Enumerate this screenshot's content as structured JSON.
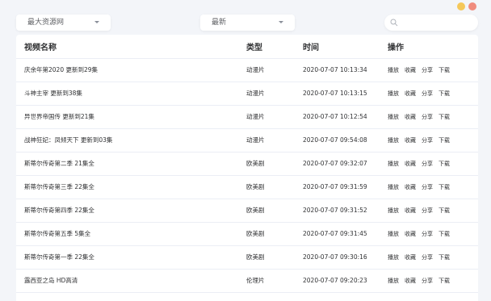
{
  "window": {
    "dots": [
      {
        "name": "minimize",
        "color": "#f5c85a"
      },
      {
        "name": "close",
        "color": "#f08c7e"
      }
    ]
  },
  "filters": {
    "source": {
      "selected": "最大资源网"
    },
    "sort": {
      "selected": "最新"
    },
    "search": {
      "value": "",
      "placeholder": ""
    }
  },
  "table": {
    "headers": {
      "name": "视频名称",
      "type": "类型",
      "time": "时间",
      "ops": "操作"
    },
    "actions": [
      "播放",
      "收藏",
      "分享",
      "下载"
    ],
    "rows": [
      {
        "name": "庆余年第2020 更新到29集",
        "type": "动漫片",
        "time": "2020-07-07 10:13:34"
      },
      {
        "name": "斗神主宰 更新到38集",
        "type": "动漫片",
        "time": "2020-07-07 10:13:15"
      },
      {
        "name": "异世界帝国传 更新到21集",
        "type": "动漫片",
        "time": "2020-07-07 10:12:54"
      },
      {
        "name": "战神狂妃：凤倾天下 更新到03集",
        "type": "动漫片",
        "time": "2020-07-07 09:54:08"
      },
      {
        "name": "斯蒂尔传奇第二季 21集全",
        "type": "欧美剧",
        "time": "2020-07-07 09:32:07"
      },
      {
        "name": "斯蒂尔传奇第三季 22集全",
        "type": "欧美剧",
        "time": "2020-07-07 09:31:59"
      },
      {
        "name": "斯蒂尔传奇第四季 22集全",
        "type": "欧美剧",
        "time": "2020-07-07 09:31:52"
      },
      {
        "name": "斯蒂尔传奇第五季 5集全",
        "type": "欧美剧",
        "time": "2020-07-07 09:31:45"
      },
      {
        "name": "斯蒂尔传奇第一季 22集全",
        "type": "欧美剧",
        "time": "2020-07-07 09:30:16"
      },
      {
        "name": "露西亚之岛 HD高清",
        "type": "伦理片",
        "time": "2020-07-07 09:20:23"
      }
    ]
  }
}
